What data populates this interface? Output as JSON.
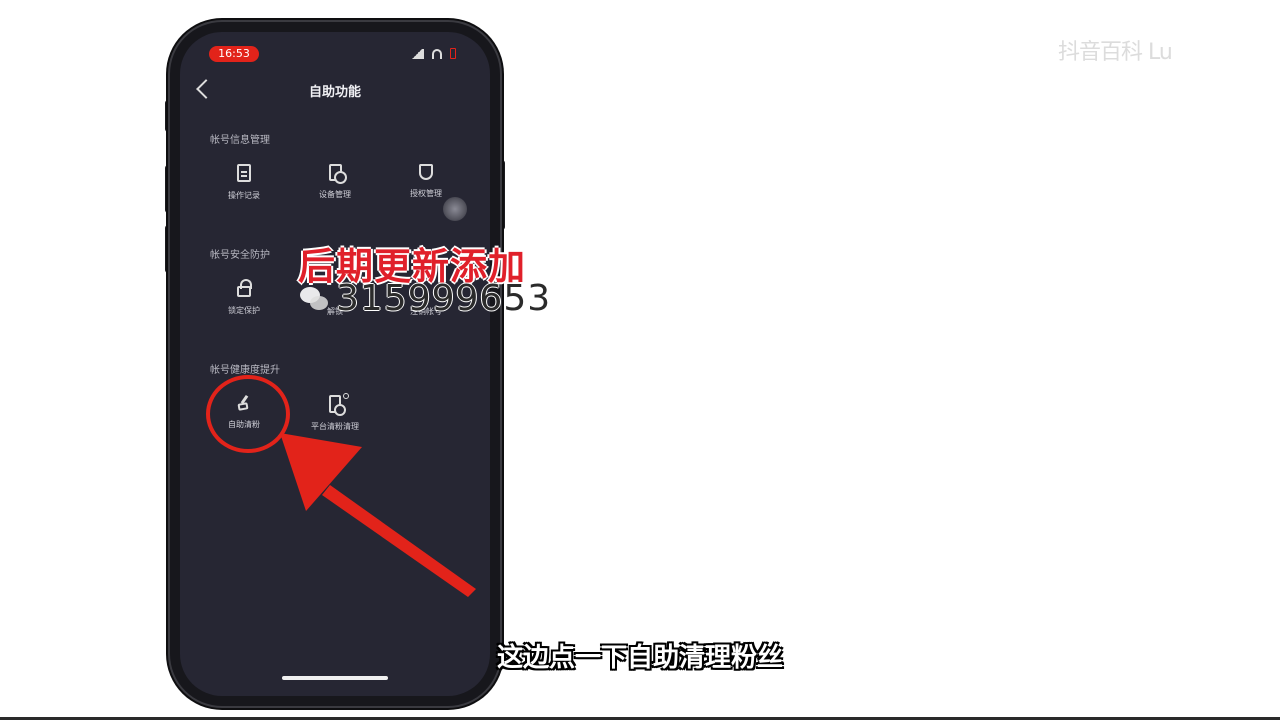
{
  "status_bar": {
    "time": "16:53"
  },
  "header": {
    "title": "自助功能"
  },
  "sections": [
    {
      "label": "帐号信息管理",
      "items": [
        {
          "label": "操作记录",
          "icon": "document-icon"
        },
        {
          "label": "设备管理",
          "icon": "device-icon"
        },
        {
          "label": "授权管理",
          "icon": "shield-icon"
        }
      ]
    },
    {
      "label": "帐号安全防护",
      "items": [
        {
          "label": "锁定保护",
          "icon": "lock-icon"
        },
        {
          "label": "解锁",
          "icon": "unlock-icon"
        },
        {
          "label": "注销帐号",
          "icon": "power-icon"
        }
      ]
    },
    {
      "label": "帐号健康度提升",
      "items": [
        {
          "label": "自助清粉",
          "icon": "brush-icon"
        },
        {
          "label": "平台清粉清理",
          "icon": "phone-clean-icon"
        }
      ]
    }
  ],
  "overlay": {
    "red_text": "后期更新添加",
    "contact_number": "315999653",
    "subtitle": "这边点一下自助清理粉丝",
    "watermark": "抖音百科 Lu"
  },
  "colors": {
    "accent_red": "#e2231a",
    "screen_bg": "#262633"
  }
}
